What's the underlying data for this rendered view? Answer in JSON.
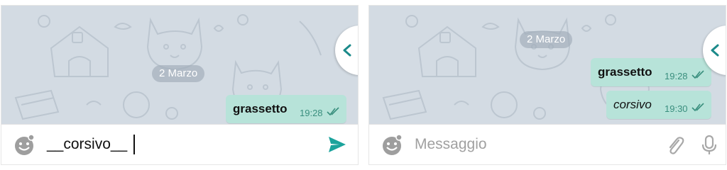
{
  "left_panel": {
    "date_label": "2 Marzo",
    "messages": [
      {
        "text": "grassetto",
        "style": "bold",
        "time": "19:28",
        "status": "read"
      }
    ],
    "input": {
      "value": "__corsivo__",
      "send_icon": "send-icon",
      "emoji_icon": "emoji-icon"
    }
  },
  "right_panel": {
    "date_label": "2 Marzo",
    "messages": [
      {
        "text": "grassetto",
        "style": "bold",
        "time": "19:28",
        "status": "read"
      },
      {
        "text": "corsivo",
        "style": "italic",
        "time": "19:30",
        "status": "read"
      }
    ],
    "input": {
      "placeholder": "Messaggio",
      "attach_icon": "paperclip-icon",
      "mic_icon": "microphone-icon",
      "emoji_icon": "emoji-icon"
    }
  },
  "colors": {
    "wallpaper": "#d3dbe3",
    "bubble": "#b7e3d9",
    "time_text": "#3a8f7e",
    "send_accent": "#1ba39c"
  }
}
